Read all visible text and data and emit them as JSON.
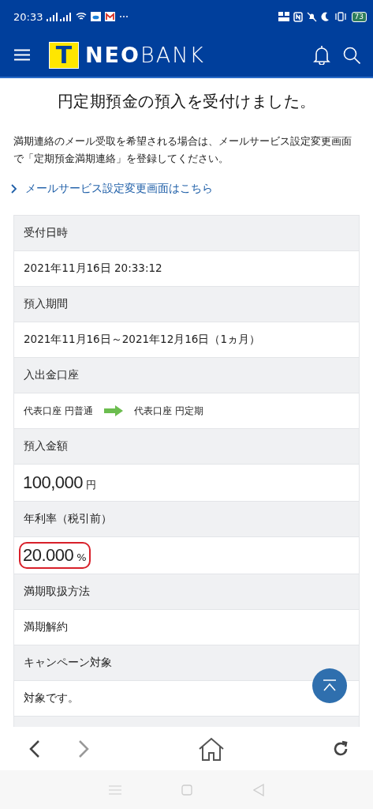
{
  "status_bar": {
    "time": "20:33",
    "battery": "73"
  },
  "header": {
    "logo": {
      "mark": "T",
      "bold": "NEO",
      "light": "BANK"
    }
  },
  "title": "円定期預金の預入を受付けました。",
  "notice": "満期連絡のメール受取を希望される場合は、メールサービス設定変更画面で「定期預金満期連絡」を登録してください。",
  "link": "メールサービス設定変更画面はこちら",
  "details": [
    {
      "label": "受付日時",
      "kind": "text",
      "value": "2021年11月16日 20:33:12"
    },
    {
      "label": "預入期間",
      "kind": "text",
      "value": "2021年11月16日～2021年12月16日（1ヵ月）"
    },
    {
      "label": "入出金口座",
      "kind": "transfer",
      "from": "代表口座 円普通",
      "to": "代表口座 円定期"
    },
    {
      "label": "預入金額",
      "kind": "amount",
      "value": "100,000",
      "unit": "円",
      "highlighted": false
    },
    {
      "label": "年利率（税引前）",
      "kind": "amount",
      "value": "20.000",
      "unit": "%",
      "highlighted": true
    },
    {
      "label": "満期取扱方法",
      "kind": "text",
      "value": "満期解約"
    },
    {
      "label": "キャンペーン対象",
      "kind": "text",
      "value": "対象です。"
    }
  ]
}
